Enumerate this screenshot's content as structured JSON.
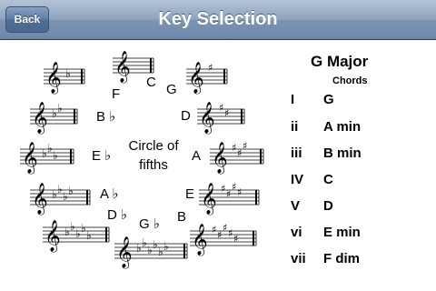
{
  "nav": {
    "back_label": "Back",
    "title": "Key Selection"
  },
  "circle": {
    "center_line1": "Circle of",
    "center_line2": "fifths",
    "keys": [
      {
        "label": "C",
        "signature": "none"
      },
      {
        "label": "G",
        "signature": "1 sharp"
      },
      {
        "label": "D",
        "signature": "2 sharps"
      },
      {
        "label": "A",
        "signature": "3 sharps"
      },
      {
        "label": "E",
        "signature": "4 sharps"
      },
      {
        "label": "B",
        "signature": "5 sharps"
      },
      {
        "label": "G ♭",
        "signature": "6 flats"
      },
      {
        "label": "D ♭",
        "signature": "5 flats"
      },
      {
        "label": "A ♭",
        "signature": "4 flats"
      },
      {
        "label": "E ♭",
        "signature": "3 flats"
      },
      {
        "label": "B ♭",
        "signature": "2 flats"
      },
      {
        "label": "F",
        "signature": "1 flat"
      }
    ],
    "selected": "G"
  },
  "panel": {
    "title": "G Major",
    "subtitle": "Chords",
    "rows": [
      {
        "numeral": "I",
        "chord": "G"
      },
      {
        "numeral": "ii",
        "chord": "A min"
      },
      {
        "numeral": "iii",
        "chord": "B min"
      },
      {
        "numeral": "IV",
        "chord": "C"
      },
      {
        "numeral": "V",
        "chord": "D"
      },
      {
        "numeral": "vi",
        "chord": "E min"
      },
      {
        "numeral": "vii",
        "chord": "F dim"
      }
    ]
  }
}
